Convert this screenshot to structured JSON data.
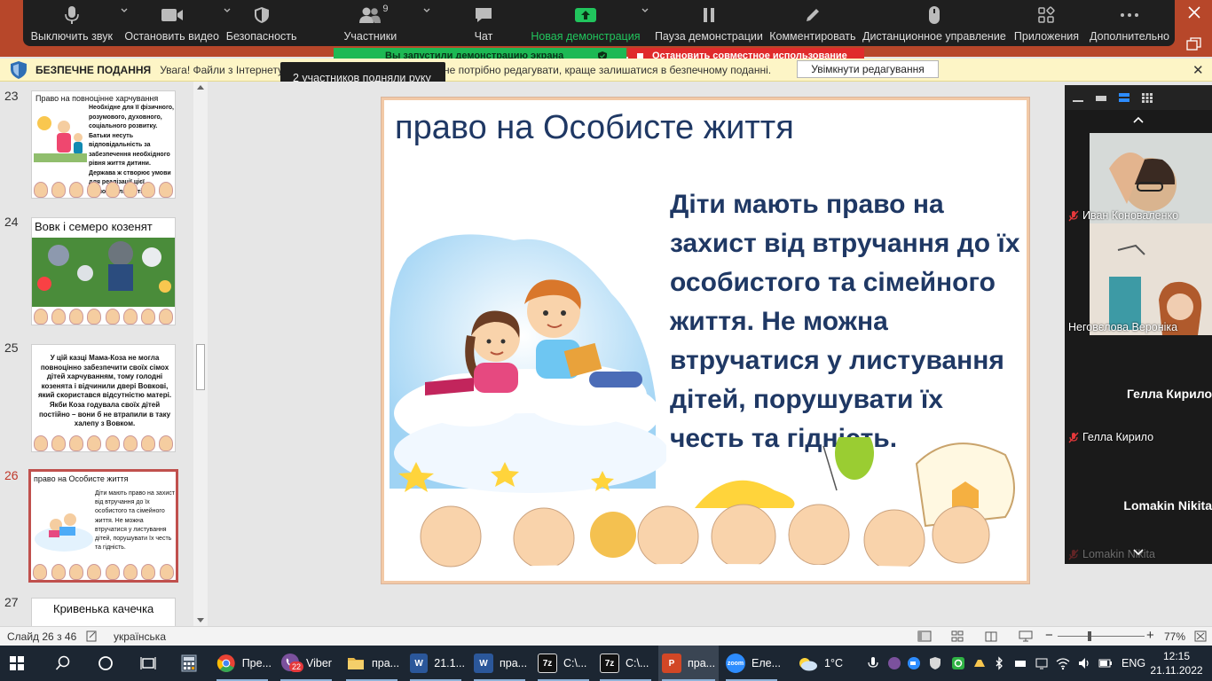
{
  "zoom_toolbar": {
    "buttons": [
      {
        "label": "Выключить звук",
        "icon": "microphone-icon"
      },
      {
        "label": "Остановить видео",
        "icon": "video-camera-icon"
      },
      {
        "label": "Безопасность",
        "icon": "shield-icon"
      },
      {
        "label": "Участники",
        "icon": "participants-icon",
        "badge": "9"
      },
      {
        "label": "Чат",
        "icon": "chat-icon"
      },
      {
        "label": "Новая демонстрация",
        "icon": "share-screen-icon"
      },
      {
        "label": "Пауза демонстрации",
        "icon": "pause-icon"
      },
      {
        "label": "Комментировать",
        "icon": "pencil-icon"
      },
      {
        "label": "Дистанционное управление",
        "icon": "mouse-icon"
      },
      {
        "label": "Приложения",
        "icon": "apps-icon"
      },
      {
        "label": "Дополнительно",
        "icon": "more-icon"
      }
    ],
    "colors": {
      "background": "#1f1f1f",
      "share_green": "#21c55d"
    }
  },
  "sharing": {
    "status": "Вы запустили демонстрацию экрана",
    "stop_label": "Остановить совместное использование"
  },
  "tooltip": {
    "text": "2 участников подняли руку"
  },
  "protected_view": {
    "title": "БЕЗПЕЧНЕ ПОДАННЯ",
    "message": "Увага! Файли з Інтернету м",
    "message_tail": "не потрібно редагувати, краще залишатися в безпечному поданні.",
    "button": "Увімкнути редагування"
  },
  "thumbnails": [
    {
      "num": "23",
      "title": "Право на повноцінне харчування",
      "text": "Необхідне для її фізичного, розумового, духовного, соціального розвитку. Батьки несуть відповідальність за забезпечення необхідного рівня життя дитини. Держава ж створює умови для реалізації цієї відповідальності."
    },
    {
      "num": "24",
      "title": "Вовк і семеро козенят"
    },
    {
      "num": "25",
      "text": "У цій казці Мама-Коза не могла повноцінно забезпечити своїх сімох дітей харчуванням, тому голодні козенята і відчинили двері Вовкові, який скористався відсутністю матері. Якби Коза годувала своїх дітей постійно – вони б не втрапили в таку халепу з Вовком."
    },
    {
      "num": "26",
      "title": "право на Особисте життя",
      "text": "Діти мають право на захист від втручання до їх особистого та сімейного життя. Не можна втручатися у листування дітей, порушувати їх честь та гідність."
    },
    {
      "num": "27",
      "title": "Кривенька качечка"
    }
  ],
  "slide": {
    "title": "право на Особисте життя",
    "body": "Діти мають право на захист від втручання до їх особистого та сімейного життя. Не можна втручатися у листування дітей, порушувати їх честь та гідність.",
    "colors": {
      "title": "#1f3864",
      "border": "#f2c9a6"
    }
  },
  "video_panel": {
    "tiles": [
      {
        "name": "Иван Коноваленко",
        "muted": true
      },
      {
        "name": "Неговєлова Вероніка",
        "muted": false
      },
      {
        "name": "Гелла Кирило",
        "big_name": "Гелла Кирило",
        "muted": true
      },
      {
        "name": "Lomakin Nikita",
        "big_name": "Lomakin Nikita",
        "muted": true
      }
    ]
  },
  "status_bar": {
    "slide_info": "Слайд 26 з 46",
    "language": "українська",
    "zoom": "77%",
    "zoom_level": 0.77
  },
  "taskbar": {
    "items": [
      {
        "label": "Пре...",
        "icon": "chrome-icon",
        "color": "#ea4335"
      },
      {
        "label": "Viber",
        "icon": "viber-icon",
        "color": "#7b519d",
        "badge": "22"
      },
      {
        "label": "пра...",
        "icon": "folder-icon",
        "color": "#e8b84a"
      },
      {
        "label": "21.1...",
        "icon": "word-icon",
        "color": "#2b579a"
      },
      {
        "label": "пра...",
        "icon": "word-icon",
        "color": "#2b579a"
      },
      {
        "label": "C:\\...",
        "icon": "7zip-icon",
        "color": "#111111"
      },
      {
        "label": "C:\\...",
        "icon": "7zip-icon",
        "color": "#111111"
      },
      {
        "label": "пра...",
        "icon": "powerpoint-icon",
        "color": "#d24726"
      },
      {
        "label": "Еле...",
        "icon": "zoom-icon",
        "color": "#2d8cff"
      }
    ],
    "weather": "1°C",
    "lang": "ENG",
    "time": "12:15",
    "date": "21.11.2022"
  }
}
